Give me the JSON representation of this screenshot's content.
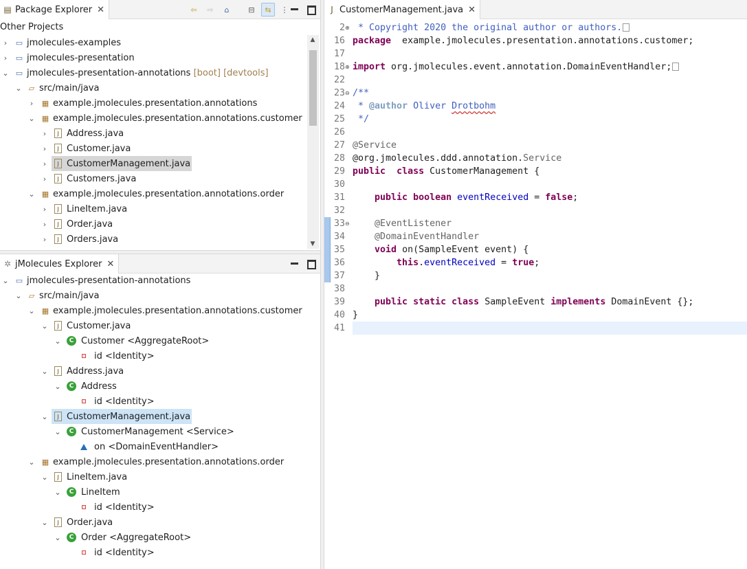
{
  "package_explorer": {
    "tab_title": "Package Explorer",
    "working_set": "Other Projects",
    "items": [
      {
        "label": "jmolecules-examples",
        "decoration": ""
      },
      {
        "label": "jmolecules-presentation",
        "decoration": ""
      },
      {
        "label": "jmolecules-presentation-annotations",
        "decoration": "[boot] [devtools]"
      },
      {
        "label": "src/main/java",
        "decoration": ""
      },
      {
        "label": "example.jmolecules.presentation.annotations",
        "decoration": ""
      },
      {
        "label": "example.jmolecules.presentation.annotations.customer",
        "decoration": ""
      },
      {
        "label": "Address.java",
        "decoration": ""
      },
      {
        "label": "Customer.java",
        "decoration": ""
      },
      {
        "label": "CustomerManagement.java",
        "decoration": ""
      },
      {
        "label": "Customers.java",
        "decoration": ""
      },
      {
        "label": "example.jmolecules.presentation.annotations.order",
        "decoration": ""
      },
      {
        "label": "LineItem.java",
        "decoration": ""
      },
      {
        "label": "Order.java",
        "decoration": ""
      },
      {
        "label": "Orders.java",
        "decoration": ""
      }
    ]
  },
  "jmolecules_explorer": {
    "tab_title": "jMolecules Explorer",
    "items": [
      {
        "label": "jmolecules-presentation-annotations"
      },
      {
        "label": "src/main/java"
      },
      {
        "label": "example.jmolecules.presentation.annotations.customer"
      },
      {
        "label": "Customer.java"
      },
      {
        "label": "Customer <AggregateRoot>"
      },
      {
        "label": "id <Identity>"
      },
      {
        "label": "Address.java"
      },
      {
        "label": "Address"
      },
      {
        "label": "id <Identity>"
      },
      {
        "label": "CustomerManagement.java"
      },
      {
        "label": "CustomerManagement <Service>"
      },
      {
        "label": "on <DomainEventHandler>"
      },
      {
        "label": "example.jmolecules.presentation.annotations.order"
      },
      {
        "label": "LineItem.java"
      },
      {
        "label": "LineItem"
      },
      {
        "label": "id <Identity>"
      },
      {
        "label": "Order.java"
      },
      {
        "label": "Order <AggregateRoot>"
      },
      {
        "label": "id <Identity>"
      }
    ]
  },
  "editor": {
    "tab_title": "CustomerManagement.java",
    "line_numbers": [
      "2",
      "16",
      "17",
      "18",
      "22",
      "23",
      "24",
      "25",
      "26",
      "27",
      "28",
      "29",
      "30",
      "31",
      "32",
      "33",
      "34",
      "35",
      "36",
      "37",
      "38",
      "39",
      "40",
      "41"
    ],
    "lines": [
      [
        [
          "cm",
          " * Copyright 2020 the original author or authors."
        ]
      ],
      [
        [
          "kw",
          "package"
        ],
        [
          "",
          "  example.jmolecules.presentation.annotations.customer;"
        ]
      ],
      [],
      [
        [
          "kw",
          "import"
        ],
        [
          "",
          " org.jmolecules.event.annotation.DomainEventHandler;"
        ]
      ],
      [],
      [
        [
          "cm",
          "/**"
        ]
      ],
      [
        [
          "cm",
          " * "
        ],
        [
          "tg",
          "@author"
        ],
        [
          "cm",
          " Oliver Drotbohm"
        ]
      ],
      [
        [
          "cm",
          " */"
        ]
      ],
      [],
      [
        [
          "an",
          "@Service"
        ]
      ],
      [
        [
          "",
          "@org.jmolecules.ddd.annotation."
        ],
        [
          "an",
          "Service"
        ]
      ],
      [
        [
          "kw",
          "public"
        ],
        [
          "",
          "  "
        ],
        [
          "kw",
          "class"
        ],
        [
          "",
          " CustomerManagement {"
        ]
      ],
      [],
      [
        [
          "",
          "    "
        ],
        [
          "kw",
          "public"
        ],
        [
          "",
          " "
        ],
        [
          "kw",
          "boolean"
        ],
        [
          "",
          " "
        ],
        [
          "fd",
          "eventReceived"
        ],
        [
          "",
          " = "
        ],
        [
          "kw",
          "false"
        ],
        [
          "",
          ";"
        ]
      ],
      [],
      [
        [
          "",
          "    "
        ],
        [
          "an",
          "@EventListener"
        ]
      ],
      [
        [
          "",
          "    "
        ],
        [
          "an",
          "@DomainEventHandler"
        ]
      ],
      [
        [
          "",
          "    "
        ],
        [
          "kw",
          "void"
        ],
        [
          "",
          " on(SampleEvent "
        ],
        [
          "",
          "event"
        ],
        [
          "",
          ") {"
        ]
      ],
      [
        [
          "",
          "        "
        ],
        [
          "kw",
          "this"
        ],
        [
          "",
          "."
        ],
        [
          "fd",
          "eventReceived"
        ],
        [
          "",
          " = "
        ],
        [
          "kw",
          "true"
        ],
        [
          "",
          ";"
        ]
      ],
      [
        [
          "",
          "    }"
        ]
      ],
      [],
      [
        [
          "",
          "    "
        ],
        [
          "kw",
          "public"
        ],
        [
          "",
          " "
        ],
        [
          "kw",
          "static"
        ],
        [
          "",
          " "
        ],
        [
          "kw",
          "class"
        ],
        [
          "",
          " SampleEvent "
        ],
        [
          "kw",
          "implements"
        ],
        [
          "",
          " DomainEvent {};"
        ]
      ],
      [
        [
          "",
          "}"
        ]
      ],
      []
    ]
  }
}
